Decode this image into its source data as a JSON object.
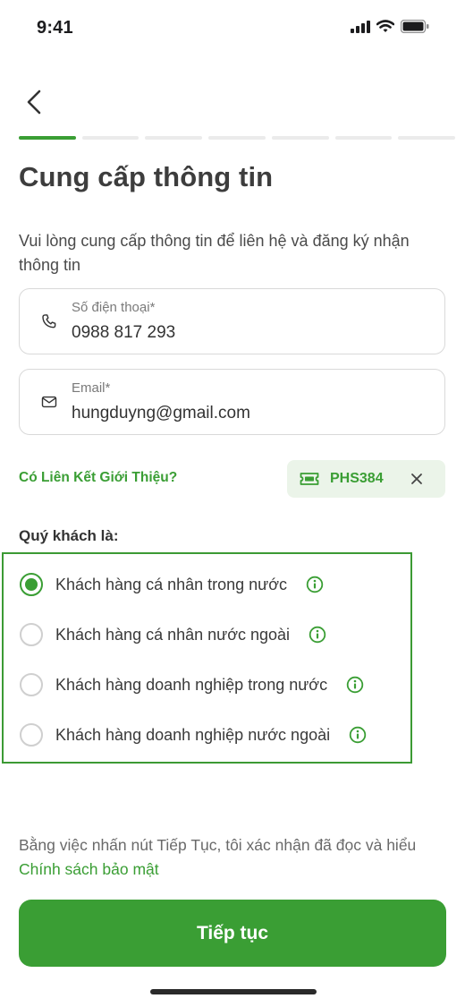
{
  "status_bar": {
    "time": "9:41"
  },
  "header": {
    "back_icon": "chevron-left-icon"
  },
  "stepper": {
    "total_steps": 7,
    "current_step": 1,
    "accent_color": "#3a9e34"
  },
  "page": {
    "title": "Cung cấp thông tin",
    "description": "Vui lòng cung cấp thông tin để liên hệ và đăng ký nhận thông tin"
  },
  "phone_field": {
    "label": "Số điện thoại*",
    "value": "0988 817 293",
    "icon": "phone-icon"
  },
  "email_field": {
    "label": "Email*",
    "value": "hungduyng@gmail.com",
    "icon": "mail-icon"
  },
  "referral": {
    "question": "Có Liên Kết Giới Thiệu?",
    "code": "PHS384",
    "icon": "ticket-icon"
  },
  "customer_type": {
    "label": "Quý khách là:",
    "options": [
      {
        "label": "Khách hàng cá nhân trong nước",
        "selected": true
      },
      {
        "label": "Khách hàng cá nhân nước ngoài",
        "selected": false
      },
      {
        "label": "Khách hàng doanh nghiệp trong nước",
        "selected": false
      },
      {
        "label": "Khách hàng doanh nghiệp nước ngoài",
        "selected": false
      }
    ]
  },
  "consent": {
    "text": "Bằng việc nhấn nút Tiếp Tục, tôi xác nhận đã đọc và hiểu ",
    "link": "Chính sách bảo mật"
  },
  "continue_button": {
    "label": "Tiếp tục"
  },
  "colors": {
    "primary": "#3a9e34",
    "chip_bg": "#ebf4e9"
  }
}
